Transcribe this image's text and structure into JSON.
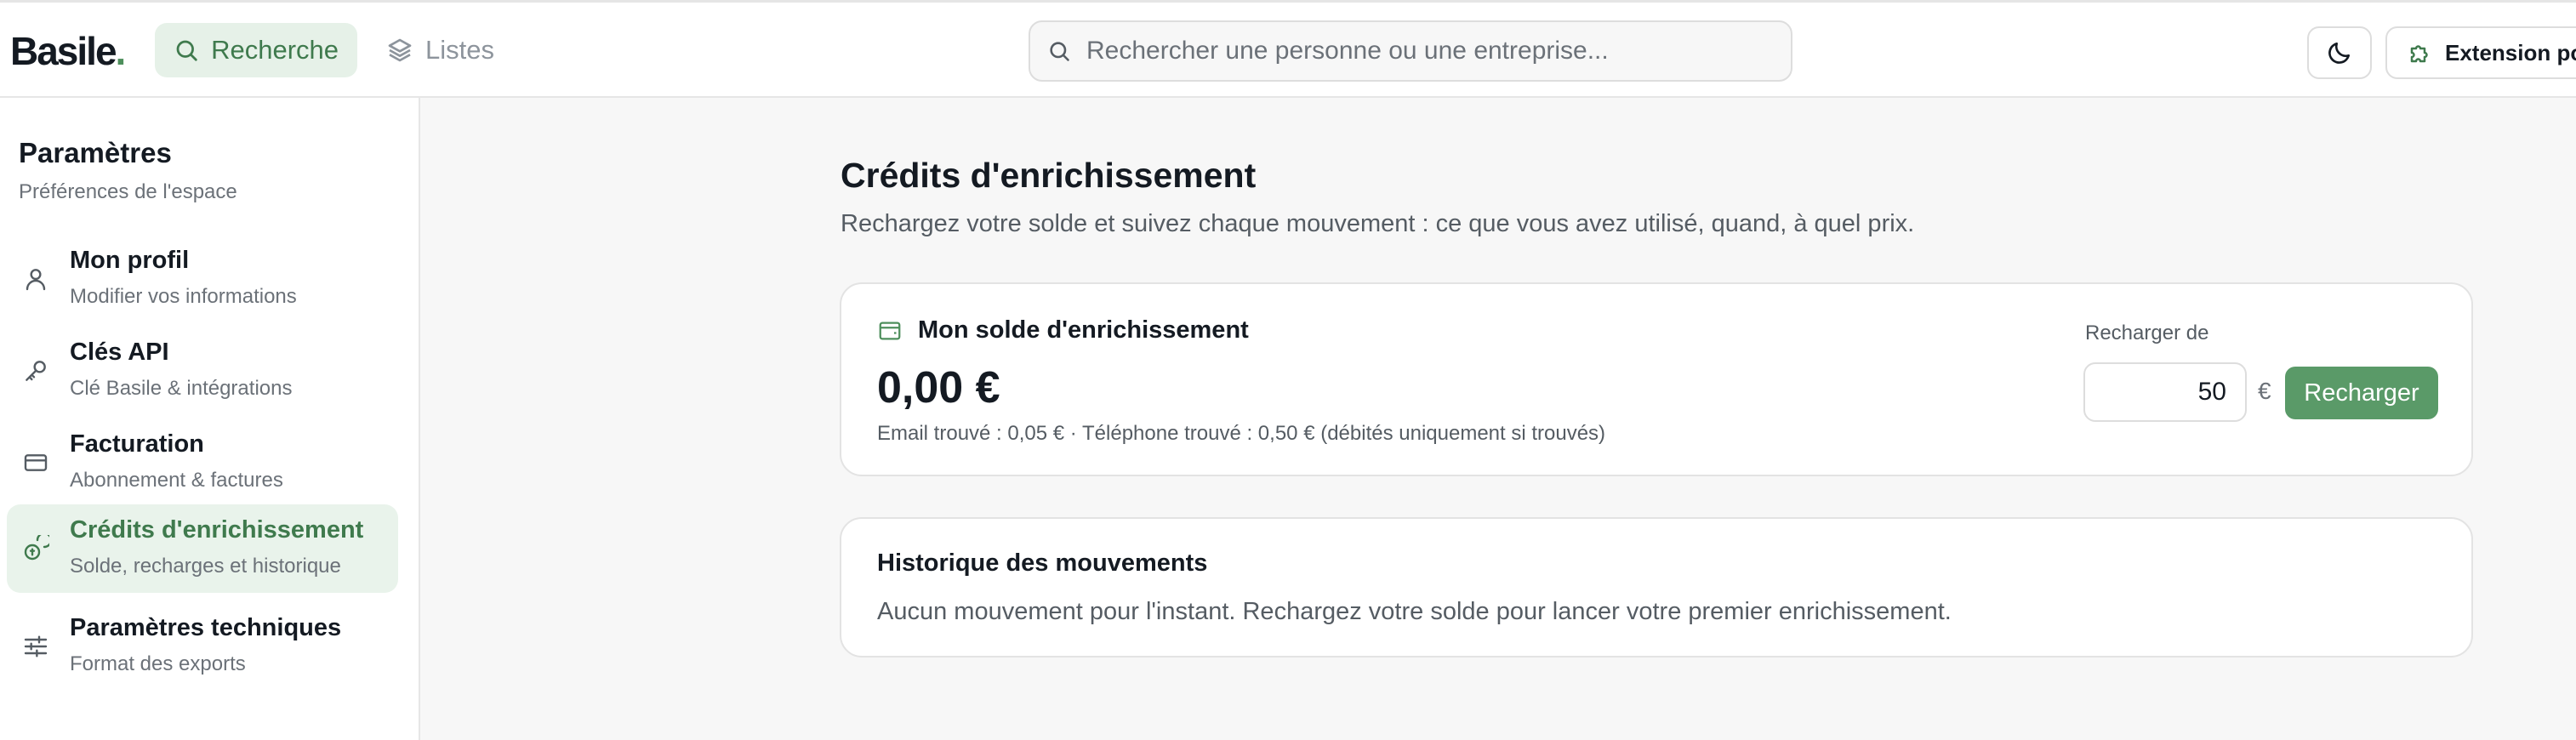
{
  "app": {
    "logo": "Basile",
    "logo_dot": "."
  },
  "topbar": {
    "tabs": [
      {
        "label": "Recherche",
        "icon": "search-icon",
        "active": true
      },
      {
        "label": "Listes",
        "icon": "layers-icon",
        "active": false
      }
    ],
    "search": {
      "placeholder": "Rechercher une personne ou une entreprise...",
      "value": ""
    },
    "theme_icon": "moon-icon",
    "extension_label": "Extension pour"
  },
  "sidebar": {
    "title": "Paramètres",
    "subtitle": "Préférences de l'espace",
    "items": [
      {
        "label": "Mon profil",
        "desc": "Modifier vos informations",
        "icon": "user-icon",
        "active": false
      },
      {
        "label": "Clés API",
        "desc": "Clé Basile & intégrations",
        "icon": "key-icon",
        "active": false
      },
      {
        "label": "Facturation",
        "desc": "Abonnement & factures",
        "icon": "credit-card-icon",
        "active": false
      },
      {
        "label": "Crédits d'enrichissement",
        "desc": "Solde, recharges et historique",
        "icon": "coins-icon",
        "active": true
      },
      {
        "label": "Paramètres techniques",
        "desc": "Format des exports",
        "icon": "sliders-icon",
        "active": false
      }
    ]
  },
  "main": {
    "title": "Crédits d'enrichissement",
    "subtitle": "Rechargez votre solde et suivez chaque mouvement : ce que vous avez utilisé, quand, à quel prix.",
    "balance": {
      "heading": "Mon solde d'enrichissement",
      "amount": "0,00 €",
      "pricing_note": "Email trouvé : 0,05 € · Téléphone trouvé : 0,50 € (débités uniquement si trouvés)",
      "recharge_label": "Recharger de",
      "recharge_value": "50",
      "currency": "€",
      "recharge_button": "Recharger"
    },
    "history": {
      "title": "Historique des mouvements",
      "empty": "Aucun mouvement pour l'instant. Rechargez votre solde pour lancer votre premier enrichissement."
    }
  },
  "colors": {
    "accent": "#5a9a68",
    "accent_text": "#3f7a4d",
    "accent_bg": "#e6f1e8"
  }
}
